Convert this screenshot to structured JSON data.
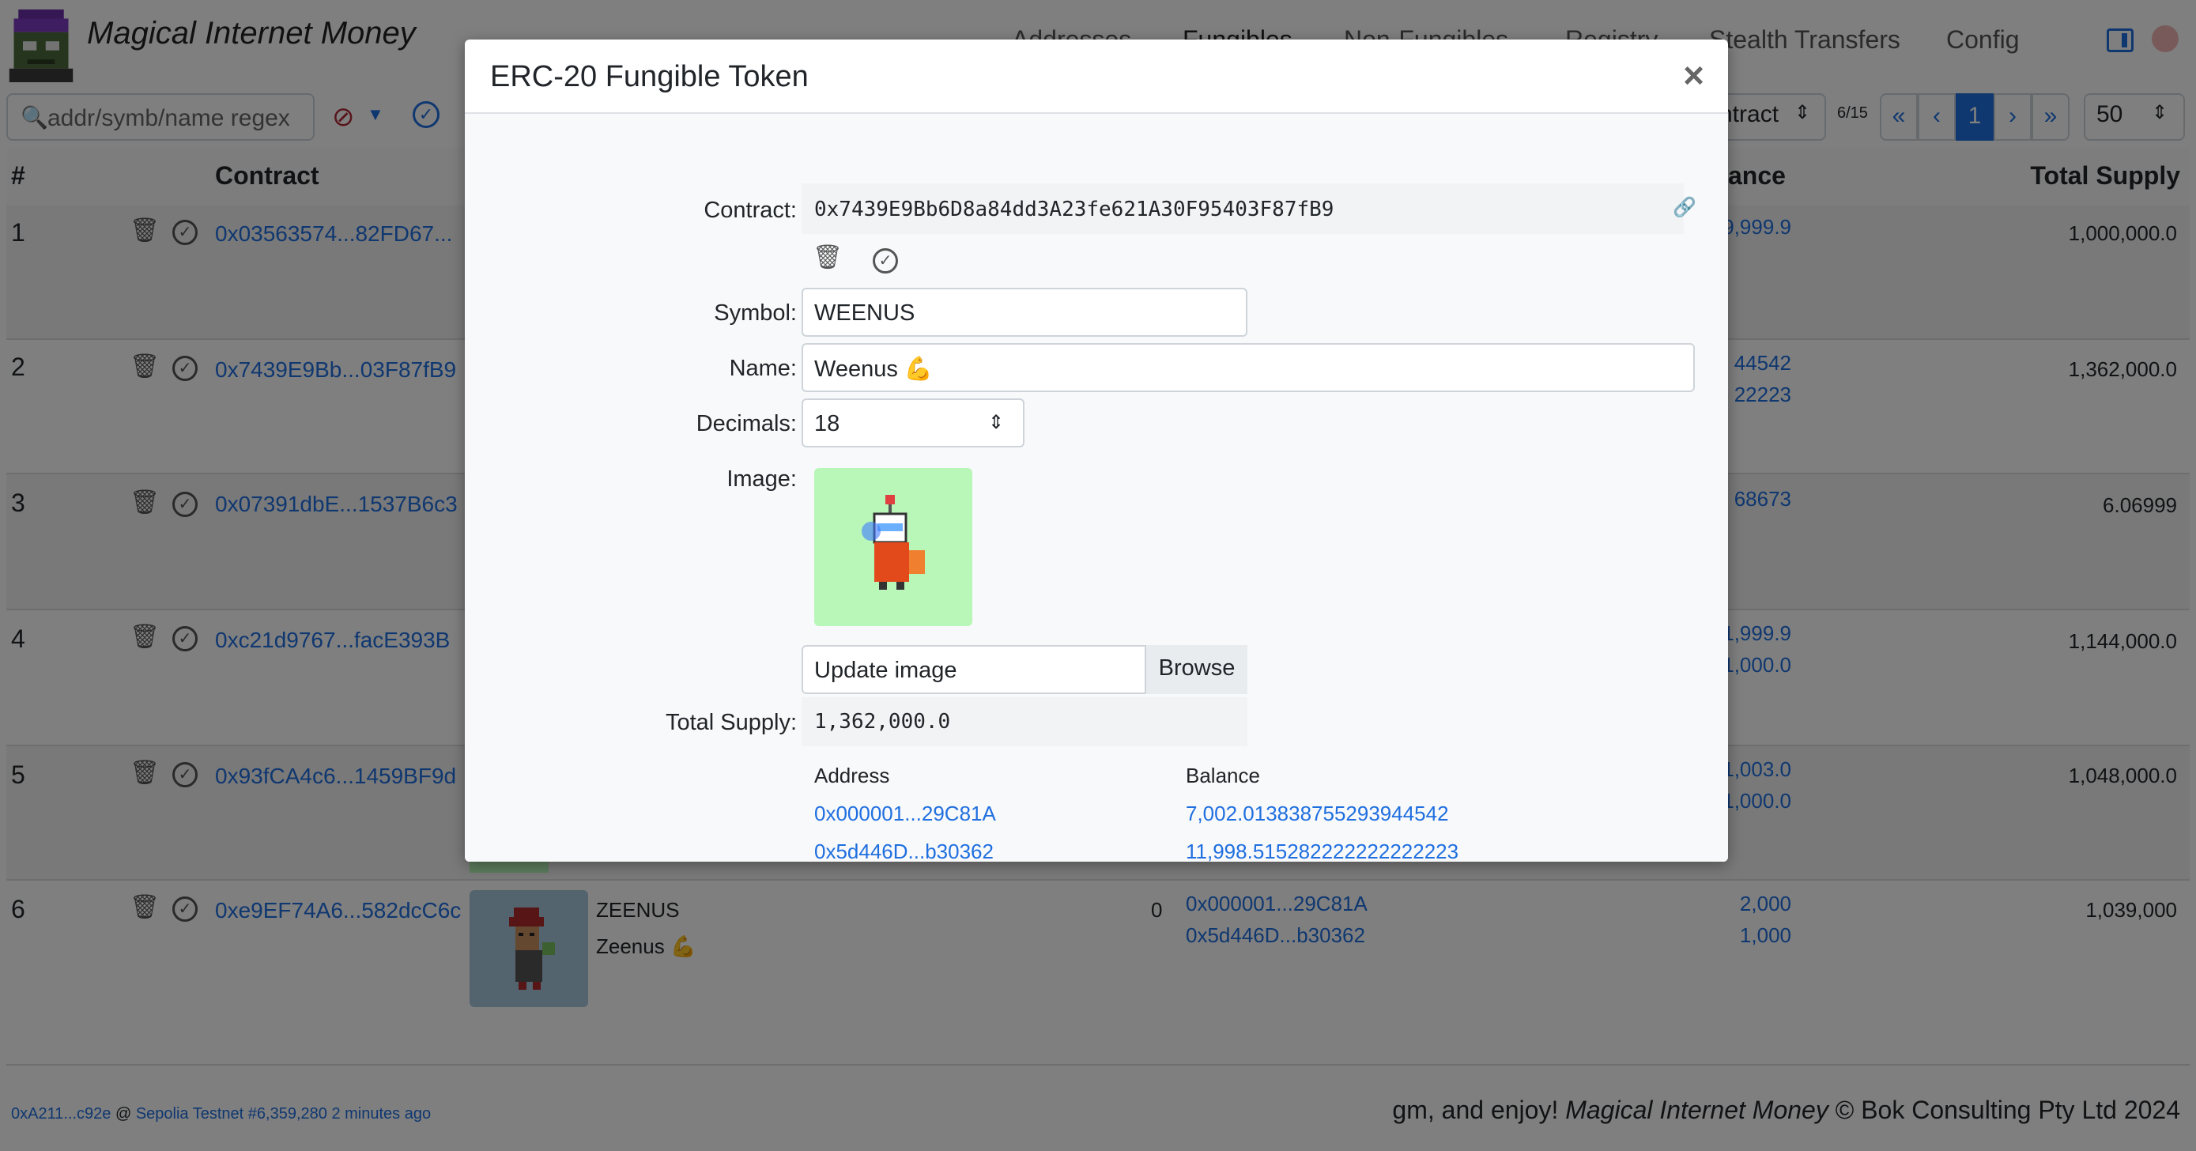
{
  "app": {
    "title": "Magical Internet Money"
  },
  "nav": {
    "addresses": "Addresses",
    "fungibles": "Fungibles",
    "non_fungibles": "Non-Fungibles",
    "registry": "Registry",
    "stealth": "Stealth Transfers",
    "config": "Config"
  },
  "toolbar": {
    "search_placeholder": "addr/symb/name regex",
    "sort_value": "ntract",
    "page_info": "6/15",
    "page_first": "«",
    "page_prev": "‹",
    "page_current": "1",
    "page_next": "›",
    "page_last": "»",
    "per_page": "50"
  },
  "table": {
    "headers": {
      "num": "#",
      "contract": "Contract",
      "balance": "ance",
      "supply": "Total Supply"
    },
    "rows": [
      {
        "num": "1",
        "contract": "0x03563574...82FD67...",
        "balances": [
          "9,999.9"
        ],
        "supply": "1,000,000.0"
      },
      {
        "num": "2",
        "contract": "0x7439E9Bb...03F87fB9",
        "balances": [
          "44542",
          "22223"
        ],
        "supply": "1,362,000.0"
      },
      {
        "num": "3",
        "contract": "0x07391dbE...1537B6c3",
        "balances": [
          "68673"
        ],
        "supply": "6.06999"
      },
      {
        "num": "4",
        "contract": "0xc21d9767...facE393B",
        "balances": [
          "1,999.9",
          "1,000.0"
        ],
        "supply": "1,144,000.0"
      },
      {
        "num": "5",
        "contract": "0x93fCA4c6...1459BF9d",
        "balances": [
          "1,003.0",
          "1,000.0"
        ],
        "supply": "1,048,000.0"
      },
      {
        "num": "6",
        "contract": "0xe9EF74A6...582dcC6c",
        "symbol": "ZEENUS",
        "name": "Zeenus 💪",
        "decimals": "0",
        "holders": [
          "0x000001...29C81A",
          "0x5d446D...b30362"
        ],
        "balances": [
          "2,000",
          "1,000"
        ],
        "supply": "1,039,000"
      }
    ]
  },
  "footer": {
    "account": "0xA211...c92e",
    "at": "@",
    "network": "Sepolia Testnet #6,359,280",
    "ago": "2 minutes ago",
    "greeting": "gm, and enjoy!",
    "brand": "Magical Internet Money",
    "copyright": "© Bok Consulting Pty Ltd 2024"
  },
  "modal": {
    "title": "ERC-20 Fungible Token",
    "close": "×",
    "labels": {
      "contract": "Contract:",
      "symbol": "Symbol:",
      "name": "Name:",
      "decimals": "Decimals:",
      "image": "Image:",
      "total_supply": "Total Supply:"
    },
    "contract": "0x7439E9Bb6D8a84dd3A23fe621A30F95403F87fB9",
    "symbol": "WEENUS",
    "name": "Weenus 💪",
    "decimals": "18",
    "image_input": "Update image",
    "browse": "Browse",
    "total_supply": "1,362,000.0",
    "holders_header": {
      "address": "Address",
      "balance": "Balance"
    },
    "holders": [
      {
        "address": "0x000001...29C81A",
        "balance": "7,002.013838755293944542"
      },
      {
        "address": "0x5d446D...b30362",
        "balance": "11,998.515282222222222223"
      }
    ]
  },
  "colors": {
    "link": "#1f6fe0",
    "image_bg": "#b8f7b8",
    "accent_blue": "#1f6fe0"
  }
}
